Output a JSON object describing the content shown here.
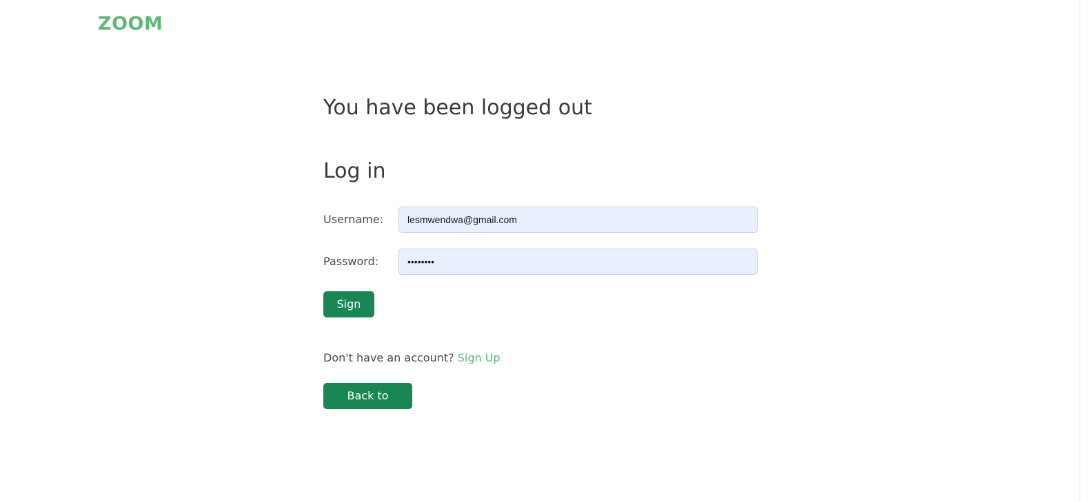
{
  "header": {
    "brand": "ZOOM"
  },
  "main": {
    "logout_message": "You have been logged out",
    "login_title": "Log in",
    "username": {
      "label": "Username:",
      "value": "lesmwendwa@gmail.com"
    },
    "password": {
      "label": "Password:",
      "value": "••••••••"
    },
    "sign_in_label": "Sign in",
    "signup_prompt": "Don't have an account?",
    "signup_link": "Sign Up",
    "back_home_label": "Back to Home"
  },
  "colors": {
    "brand": "#5cb973",
    "primary_button": "#198754",
    "input_autofill": "#e8f0fe"
  }
}
